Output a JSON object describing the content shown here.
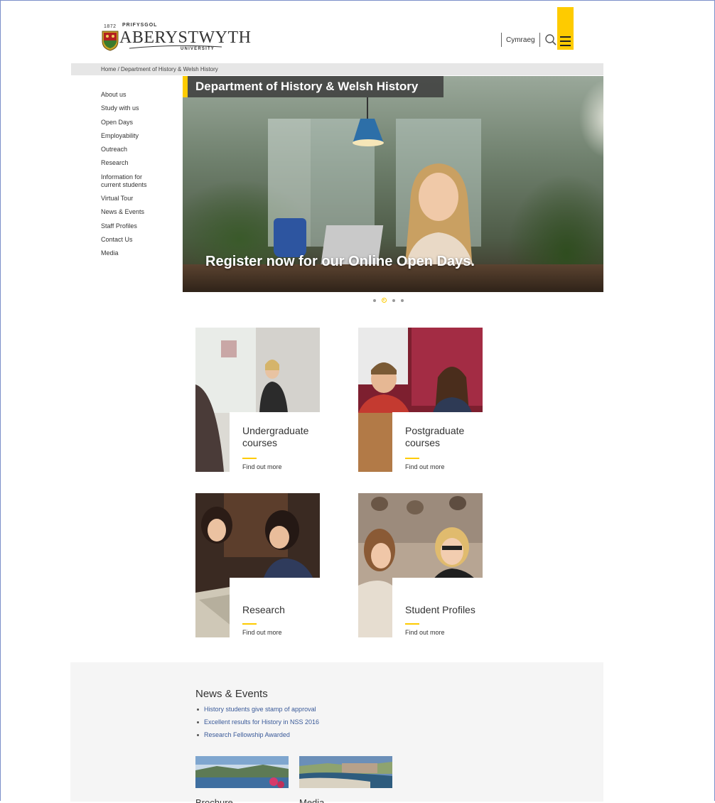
{
  "header": {
    "logo_year": "1872",
    "logo_prifysgol": "PRIFYSGOL",
    "logo_name": "ABERYSTWYTH",
    "logo_university": "UNIVERSITY",
    "language_link": "Cymraeg",
    "icons": [
      "search-icon",
      "hamburger-menu-icon"
    ],
    "accent_color": "#fecb00"
  },
  "breadcrumb": {
    "text": "Home / Department of History & Welsh History"
  },
  "sidebar": {
    "items": [
      {
        "label": "About us"
      },
      {
        "label": "Study with us"
      },
      {
        "label": "Open Days"
      },
      {
        "label": "Employability"
      },
      {
        "label": "Outreach"
      },
      {
        "label": "Research"
      },
      {
        "label": "Information for current students"
      },
      {
        "label": "Virtual Tour"
      },
      {
        "label": "News & Events"
      },
      {
        "label": "Staff Profiles"
      },
      {
        "label": "Contact Us"
      },
      {
        "label": "Media"
      }
    ]
  },
  "hero": {
    "title": "Department of History & Welsh History",
    "caption": "Register now for our Online Open Days.",
    "slide_count": 4,
    "active_slide": 2
  },
  "cards": [
    {
      "title": "Undergraduate courses",
      "link": "Find out more"
    },
    {
      "title": "Postgraduate courses",
      "link": "Find out more"
    },
    {
      "title": "Research",
      "link": "Find out more"
    },
    {
      "title": "Student Profiles",
      "link": "Find out more"
    }
  ],
  "news": {
    "heading": "News & Events",
    "items": [
      {
        "label": "History students give stamp of approval"
      },
      {
        "label": "Excellent results for History in NSS 2016"
      },
      {
        "label": "Research Fellowship Awarded"
      }
    ],
    "thumbs": [
      {
        "label": "Brochure"
      },
      {
        "label": "Media"
      }
    ]
  }
}
